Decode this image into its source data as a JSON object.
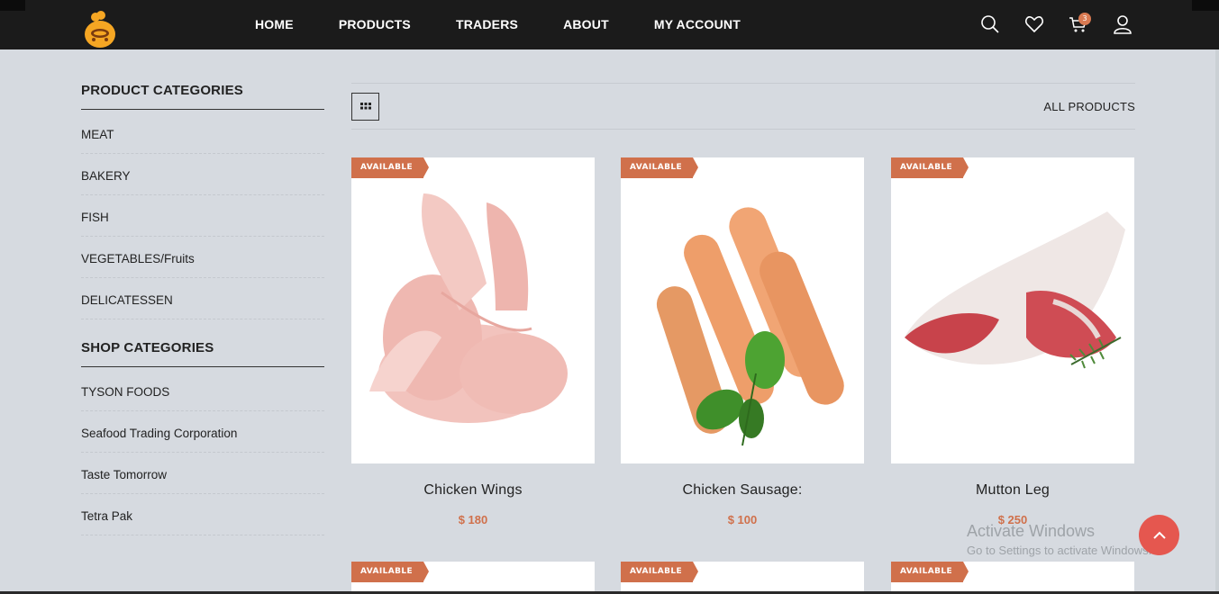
{
  "nav": {
    "items": [
      "HOME",
      "PRODUCTS",
      "TRADERS",
      "ABOUT",
      "MY ACCOUNT"
    ],
    "cart_count": "3",
    "icons": [
      "search-icon",
      "heart-icon",
      "cart-icon",
      "user-icon"
    ]
  },
  "sidebar": {
    "product_title": "PRODUCT CATEGORIES",
    "product_categories": [
      "MEAT",
      "BAKERY",
      "FISH",
      "VEGETABLES/Fruits",
      "DELICATESSEN"
    ],
    "shop_title": "SHOP CATEGORIES",
    "shop_categories": [
      "TYSON FOODS",
      "Seafood Trading Corporation",
      "Taste Tomorrow",
      "Tetra Pak"
    ]
  },
  "toolbar": {
    "all_products": "ALL PRODUCTS"
  },
  "products": [
    {
      "badge": "AVAILABLE",
      "name": "Chicken Wings",
      "price": "$ 180"
    },
    {
      "badge": "AVAILABLE",
      "name": "Chicken Sausage:",
      "price": "$ 100"
    },
    {
      "badge": "AVAILABLE",
      "name": "Mutton Leg",
      "price": "$ 250"
    },
    {
      "badge": "AVAILABLE"
    },
    {
      "badge": "AVAILABLE"
    },
    {
      "badge": "AVAILABLE"
    }
  ],
  "watermark": {
    "line1": "Activate Windows",
    "line2": "Go to Settings to activate Windows."
  },
  "colors": {
    "accent": "#d0704b",
    "topbar": "#1b1b1b",
    "background": "#d6dae0",
    "back_to_top": "#e5574f"
  }
}
